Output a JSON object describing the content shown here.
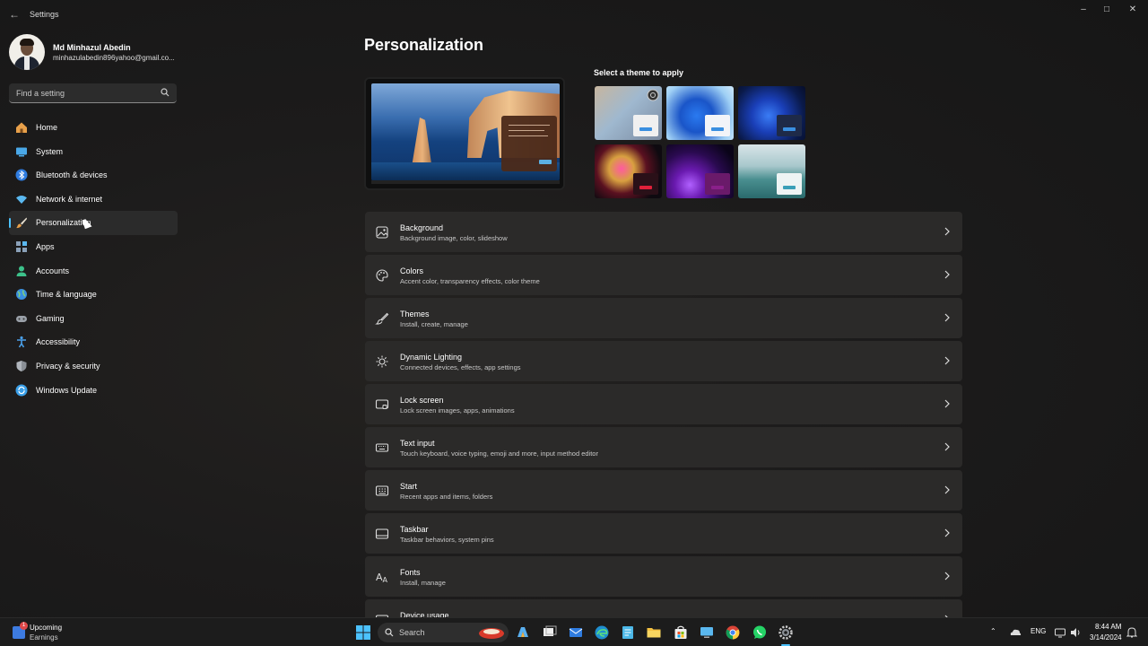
{
  "window": {
    "app_title": "Settings",
    "controls": [
      "minimize",
      "maximize",
      "close"
    ]
  },
  "profile": {
    "name": "Md Minhazul Abedin",
    "email": "minhazulabedin896yahoo@gmail.co..."
  },
  "search": {
    "placeholder": "Find a setting"
  },
  "nav": {
    "items": [
      {
        "label": "Home",
        "icon": "home-icon",
        "color": "#e8a04a"
      },
      {
        "label": "System",
        "icon": "system-icon",
        "color": "#4aa8e8"
      },
      {
        "label": "Bluetooth & devices",
        "icon": "bluetooth-icon",
        "color": "#2f7ce0"
      },
      {
        "label": "Network & internet",
        "icon": "wifi-icon",
        "color": "#5ab8f0"
      },
      {
        "label": "Personalization",
        "icon": "brush-icon",
        "color": "#e8a04a"
      },
      {
        "label": "Apps",
        "icon": "apps-icon",
        "color": "#8aa0b8"
      },
      {
        "label": "Accounts",
        "icon": "accounts-icon",
        "color": "#3cc18a"
      },
      {
        "label": "Time & language",
        "icon": "globe-icon",
        "color": "#3a8fe0"
      },
      {
        "label": "Gaming",
        "icon": "gamepad-icon",
        "color": "#9aa0a8"
      },
      {
        "label": "Accessibility",
        "icon": "accessibility-icon",
        "color": "#4a9fe8"
      },
      {
        "label": "Privacy & security",
        "icon": "shield-icon",
        "color": "#8a8f96"
      },
      {
        "label": "Windows Update",
        "icon": "update-icon",
        "color": "#3a9fe8"
      }
    ],
    "active": "Personalization"
  },
  "main": {
    "title": "Personalization",
    "theme_heading": "Select a theme to apply",
    "cards": [
      {
        "title": "Background",
        "subtitle": "Background image, color, slideshow",
        "icon": "image-icon"
      },
      {
        "title": "Colors",
        "subtitle": "Accent color, transparency effects, color theme",
        "icon": "palette-icon"
      },
      {
        "title": "Themes",
        "subtitle": "Install, create, manage",
        "icon": "brush-icon"
      },
      {
        "title": "Dynamic Lighting",
        "subtitle": "Connected devices, effects, app settings",
        "icon": "lighting-icon"
      },
      {
        "title": "Lock screen",
        "subtitle": "Lock screen images, apps, animations",
        "icon": "lock-screen-icon"
      },
      {
        "title": "Text input",
        "subtitle": "Touch keyboard, voice typing, emoji and more, input method editor",
        "icon": "keyboard-icon"
      },
      {
        "title": "Start",
        "subtitle": "Recent apps and items, folders",
        "icon": "start-icon"
      },
      {
        "title": "Taskbar",
        "subtitle": "Taskbar behaviors, system pins",
        "icon": "taskbar-icon"
      },
      {
        "title": "Fonts",
        "subtitle": "Install, manage",
        "icon": "fonts-icon"
      },
      {
        "title": "Device usage",
        "subtitle": "",
        "icon": "device-usage-icon"
      }
    ]
  },
  "taskbar": {
    "weather_title": "Upcoming",
    "weather_sub": "Earnings",
    "badge_count": "1",
    "search_label": "Search",
    "language": "ENG",
    "time": "8:44 AM",
    "date": "3/14/2024"
  },
  "colors": {
    "accent": "#4cc2ff"
  }
}
